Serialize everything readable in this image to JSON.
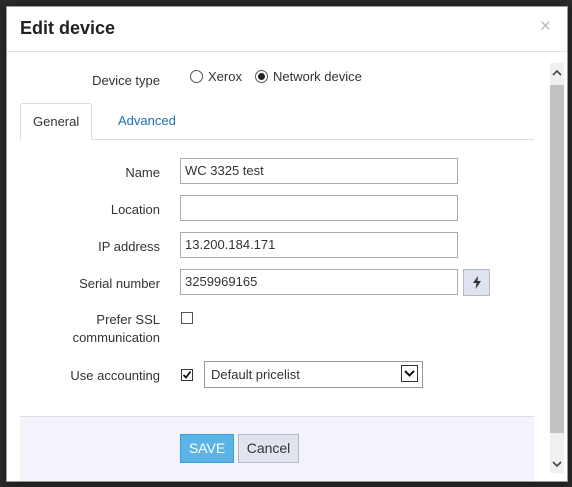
{
  "dialog": {
    "title": "Edit device",
    "close_glyph": "×"
  },
  "device_type": {
    "label": "Device type",
    "options": [
      {
        "label": "Xerox",
        "checked": false
      },
      {
        "label": "Network device",
        "checked": true
      }
    ]
  },
  "tabs": [
    {
      "label": "General",
      "active": true
    },
    {
      "label": "Advanced",
      "active": false
    }
  ],
  "fields": {
    "name": {
      "label": "Name",
      "value": "WC 3325 test"
    },
    "location": {
      "label": "Location",
      "value": ""
    },
    "ip_address": {
      "label": "IP address",
      "value": "13.200.184.171"
    },
    "serial_number": {
      "label": "Serial number",
      "value": "3259969165"
    },
    "prefer_ssl": {
      "label_line1": "Prefer SSL",
      "label_line2": "communication",
      "checked": false
    },
    "use_accounting": {
      "label": "Use accounting",
      "checked": true,
      "pricelist": "Default pricelist"
    }
  },
  "icons": {
    "generate": "lightning-icon",
    "close": "close-icon",
    "dropdown": "chevron-down-icon"
  },
  "footer": {
    "save_label": "SAVE",
    "cancel_label": "Cancel"
  },
  "colors": {
    "primary_button": "#5cb3e6",
    "link": "#1a73b8",
    "footer_bg": "#f3f4fb"
  }
}
